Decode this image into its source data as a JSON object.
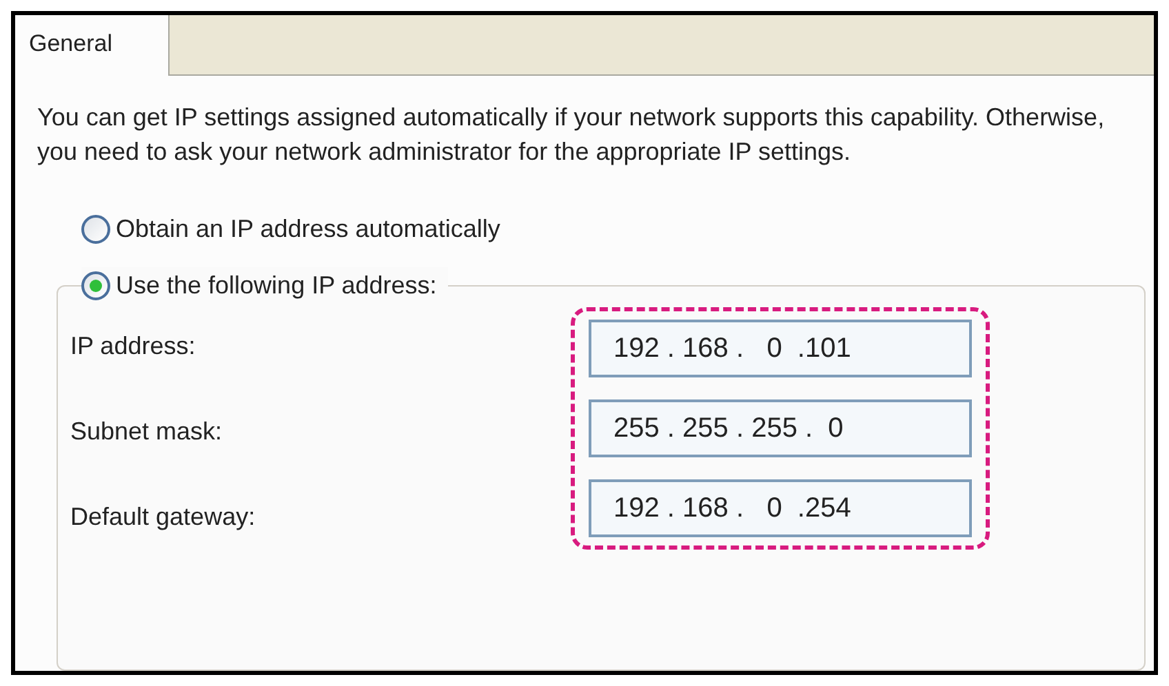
{
  "tabs": [
    {
      "label": "General",
      "selected": true
    }
  ],
  "description": "You can get IP settings assigned automatically if your network supports this capability. Otherwise, you need to ask your network administrator for the appropriate IP settings.",
  "options": [
    {
      "label": "Obtain an IP address automatically",
      "selected": false
    },
    {
      "label": "Use the following IP address:",
      "selected": true
    }
  ],
  "fields": [
    {
      "label": "IP address:",
      "value": "192 . 168 .   0  .101"
    },
    {
      "label": "Subnet mask:",
      "value": "255 . 255 . 255 .  0"
    },
    {
      "label": "Default gateway:",
      "value": "192 . 168 .   0  .254"
    }
  ]
}
